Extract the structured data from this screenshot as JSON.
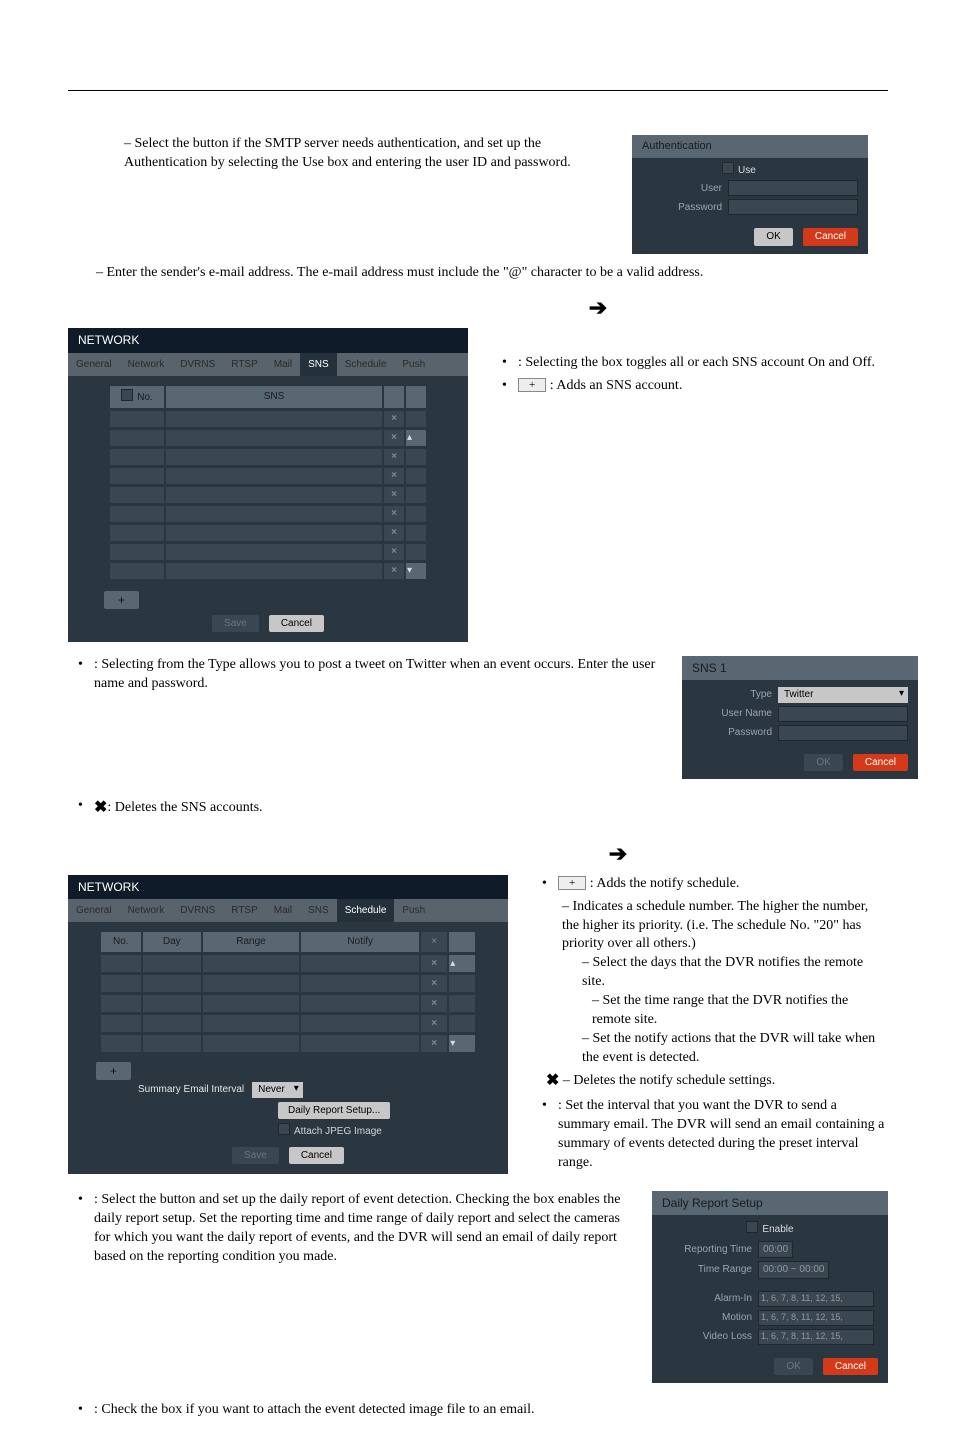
{
  "para1_prefix": "– Select the button if the SMTP server needs authentication, and set up the Authentication by selecting the Use box and entering the user ID and password.",
  "para2": "– Enter the sender's e-mail address.  The e-mail address must include the \"@\" character to be a valid address.",
  "arrow": "➔",
  "auth_panel": {
    "title": "Authentication",
    "use": "Use",
    "user": "User",
    "password": "Password",
    "ok": "OK",
    "cancel": "Cancel"
  },
  "network_panel_title": "NETWORK",
  "tabs": [
    "General",
    "Network",
    "DVRNS",
    "RTSP",
    "Mail",
    "SNS",
    "Schedule",
    "Push"
  ],
  "sns_table": {
    "no": "No.",
    "sns": "SNS"
  },
  "save": "Save",
  "cancel": "Cancel",
  "plus": "+",
  "sns_bullets": {
    "b1a": ": Selecting the box toggles all or each SNS account On and Off.",
    "b1b": ":  Adds an SNS account."
  },
  "twitter_bullet": ": Selecting            from the Type allows you to post a tweet on Twitter when an event occurs.  Enter the user name and password.",
  "delete_sns_bullet": ":  Deletes the SNS accounts.",
  "sns1": {
    "title": "SNS 1",
    "type": "Type",
    "twitter": "Twitter",
    "user": "User Name",
    "password": "Password",
    "ok": "OK",
    "cancel": "Cancel"
  },
  "schedule_table": {
    "no": "No.",
    "day": "Day",
    "range": "Range",
    "notify": "Notify"
  },
  "summary_email_interval": "Summary Email Interval",
  "never": "Never",
  "daily_report_setup_btn": "Daily Report Setup...",
  "attach_jpeg": "Attach JPEG Image",
  "sched_text": {
    "adds": ":  Adds the notify schedule.",
    "indent1": "– Indicates a schedule number.  The higher the number, the higher its priority. (i.e. The schedule No. \"20\" has priority over all others.)",
    "days": "– Select the days that the DVR notifies the remote site.",
    "range": "– Set the time range that the DVR notifies the remote site.",
    "notify": "– Set the notify actions that the DVR will take when the event is detected.",
    "del": "– Deletes the notify schedule settings.",
    "sei": ": Set the interval that you want the DVR to send a summary email. The DVR will send an email containing a summary of events detected during the preset interval range."
  },
  "daily_para": ": Select the button and set up the daily report of event detection.  Checking the           box enables the daily report setup.  Set the reporting time and time range of daily report and select the cameras for which you want the daily report of events, and the DVR will send an email of daily report based on the reporting condition you made.",
  "drs_panel": {
    "title": "Daily Report Setup",
    "enable": "Enable",
    "rep_time": "Reporting Time",
    "rep_time_v": "00:00",
    "time_range": "Time Range",
    "time_range_v": "00:00 ~ 00:00",
    "alarm": "Alarm-In",
    "motion": "Motion",
    "vloss": "Video Loss",
    "cams": "1, 6, 7, 8, 11, 12, 15,",
    "ok": "OK",
    "cancel": "Cancel"
  },
  "attach_bullet": ": Check the box if you want to attach the event detected image file to an email."
}
